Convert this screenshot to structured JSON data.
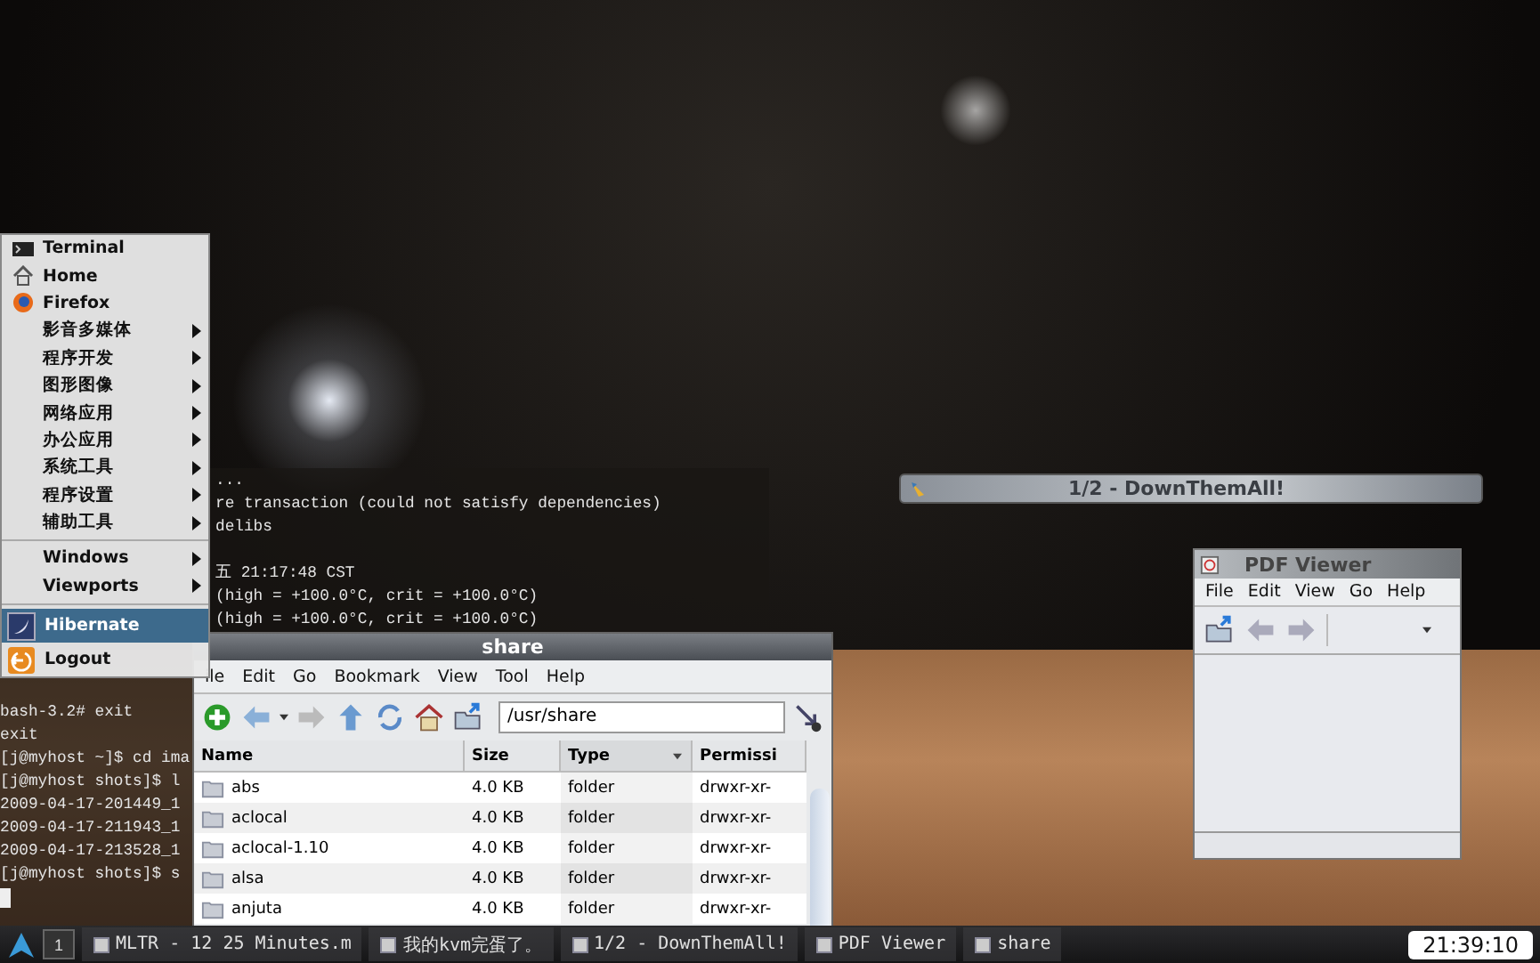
{
  "menu": {
    "apps": [
      {
        "label": "Terminal",
        "selected": false
      },
      {
        "label": "Home",
        "selected": false
      },
      {
        "label": "Firefox",
        "selected": false
      }
    ],
    "categories": [
      {
        "label": "影音多媒体",
        "selected": false
      },
      {
        "label": "程序开发",
        "selected": false
      },
      {
        "label": "图形图像",
        "selected": false
      },
      {
        "label": "网络应用",
        "selected": false
      },
      {
        "label": "办公应用",
        "selected": false
      },
      {
        "label": "系统工具",
        "selected": false
      },
      {
        "label": "程序设置",
        "selected": false
      },
      {
        "label": "辅助工具",
        "selected": false
      }
    ],
    "window_items": [
      {
        "label": "Windows",
        "selected": false
      },
      {
        "label": "Viewports",
        "selected": false
      }
    ],
    "session": [
      {
        "label": "Hibernate",
        "selected": true
      },
      {
        "label": "Logout",
        "selected": false
      }
    ]
  },
  "terminal": {
    "upper_lines": [
      {
        "kind": "text",
        "text": "..."
      },
      {
        "kind": "text",
        "text": "re transaction (could not satisfy dependencies)"
      },
      {
        "kind": "text",
        "text": "delibs"
      },
      {
        "kind": "blank"
      },
      {
        "kind": "text",
        "text": "五 21:17:48 CST"
      },
      {
        "kind": "text",
        "text": "(high = +100.0°C, crit = +100.0°C)"
      },
      {
        "kind": "text",
        "text": "(high = +100.0°C, crit = +100.0°C)"
      }
    ],
    "lower_lines": [
      {
        "kind": "text",
        "text": "bash-3.2# exit"
      },
      {
        "kind": "text",
        "text": "exit"
      },
      {
        "kind": "text",
        "text": "[j@myhost ~]$ cd ima"
      },
      {
        "kind": "text",
        "text": "[j@myhost shots]$ l"
      },
      {
        "kind": "text",
        "text": "2009-04-17-201449_1"
      },
      {
        "kind": "text",
        "text": "2009-04-17-211943_1"
      },
      {
        "kind": "text",
        "text": "2009-04-17-213528_1"
      },
      {
        "kind": "text",
        "text": "[j@myhost shots]$ s"
      }
    ]
  },
  "file_manager": {
    "title": "share",
    "menu": [
      "ile",
      "Edit",
      "Go",
      "Bookmark",
      "View",
      "Tool",
      "Help"
    ],
    "location": "/usr/share",
    "columns": [
      "Name",
      "Size",
      "Type",
      "Permissi"
    ],
    "rows": [
      [
        "abs",
        "4.0 KB",
        "folder",
        "drwxr-xr-"
      ],
      [
        "aclocal",
        "4.0 KB",
        "folder",
        "drwxr-xr-"
      ],
      [
        "aclocal-1.10",
        "4.0 KB",
        "folder",
        "drwxr-xr-"
      ],
      [
        "alsa",
        "4.0 KB",
        "folder",
        "drwxr-xr-"
      ],
      [
        "anjuta",
        "4.0 KB",
        "folder",
        "drwxr-xr-"
      ]
    ]
  },
  "downthemall": {
    "title": "1/2 - DownThemAll!"
  },
  "pdf_viewer": {
    "title": "PDF Viewer",
    "menu": [
      "File",
      "Edit",
      "View",
      "Go",
      "Help"
    ]
  },
  "taskbar": {
    "workspace": "1",
    "tasks": [
      "MLTR - 12 25 Minutes.m",
      "我的kvm完蛋了。",
      "1/2 - DownThemAll!",
      "PDF Viewer",
      "share"
    ],
    "clock": "21:39:10"
  }
}
